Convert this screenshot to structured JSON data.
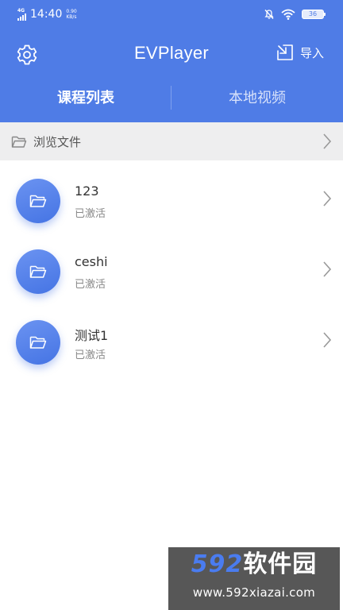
{
  "status_bar": {
    "network": "4G",
    "time": "14:40",
    "speed_value": "0.90",
    "speed_unit": "KB/s",
    "battery": "36",
    "icons": [
      "signal-icon",
      "mute-icon",
      "wifi-icon",
      "battery-icon"
    ]
  },
  "header": {
    "title": "EVPlayer",
    "import_label": "导入",
    "tabs": [
      {
        "label": "课程列表",
        "active": true
      },
      {
        "label": "本地视频",
        "active": false
      }
    ]
  },
  "browse": {
    "label": "浏览文件"
  },
  "courses": [
    {
      "name": "123",
      "status": "已激活"
    },
    {
      "name": "ceshi",
      "status": "已激活"
    },
    {
      "name": "测试1",
      "status": "已激活"
    }
  ],
  "watermark": {
    "brand_num": "592",
    "brand_text": "软件园",
    "url": "www.592xiazai.com"
  },
  "colors": {
    "accent": "#4f7ce6",
    "browse_bg": "#eeeeef",
    "text_primary": "#333333",
    "text_secondary": "#888888"
  }
}
